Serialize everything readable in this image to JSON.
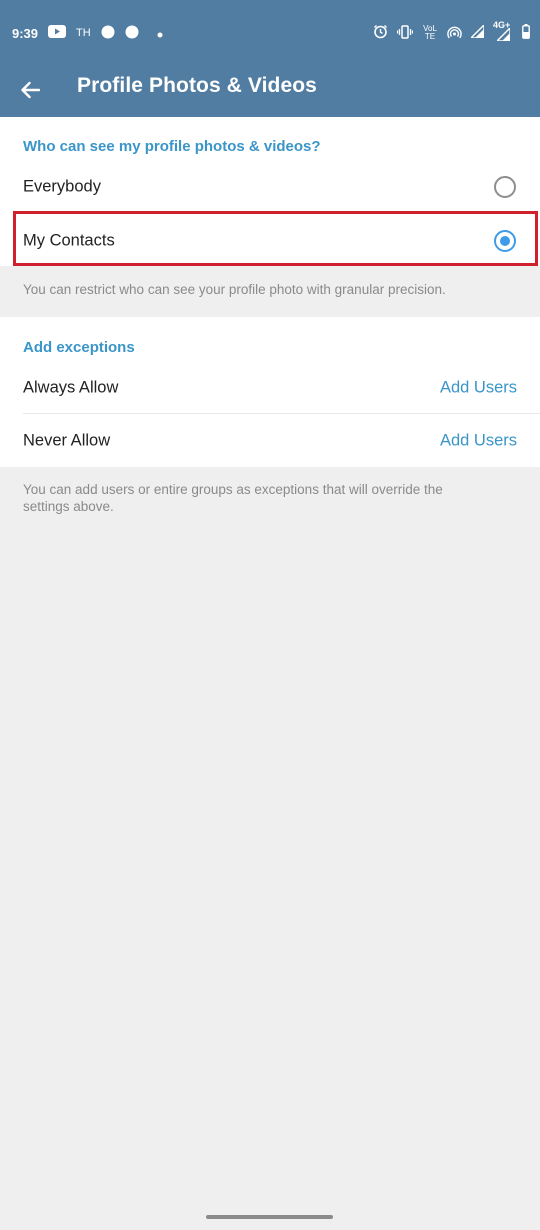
{
  "statusbar": {
    "time": "9:39",
    "carrier_label": "TH",
    "volte_label": "VoLTE",
    "network_label": "4G+",
    "icons": [
      "youtube-icon",
      "notification-dot-icon",
      "notification-dot-icon",
      "small-dot-icon",
      "alarm-icon",
      "vibrate-icon",
      "volte-icon",
      "hotspot-icon",
      "signal-icon",
      "signal-4g-icon",
      "battery-icon"
    ]
  },
  "appbar": {
    "title": "Profile Photos & Videos",
    "back_icon": "arrow-left-icon"
  },
  "visibility": {
    "header": "Who can see my profile photos & videos?",
    "options": [
      {
        "label": "Everybody",
        "selected": false
      },
      {
        "label": "My Contacts",
        "selected": true
      }
    ],
    "note": "You can restrict who can see your profile photo with granular precision."
  },
  "exceptions": {
    "header": "Add exceptions",
    "rows": [
      {
        "label": "Always Allow",
        "action": "Add Users"
      },
      {
        "label": "Never Allow",
        "action": "Add Users"
      }
    ],
    "note": "You can add users or entire groups as exceptions that will override the settings above."
  },
  "colors": {
    "header_bg": "#517da2",
    "accent": "#3a95c9",
    "radio_selected": "#3d9be9",
    "highlight_border": "#d0202d",
    "page_bg": "#efefef"
  }
}
